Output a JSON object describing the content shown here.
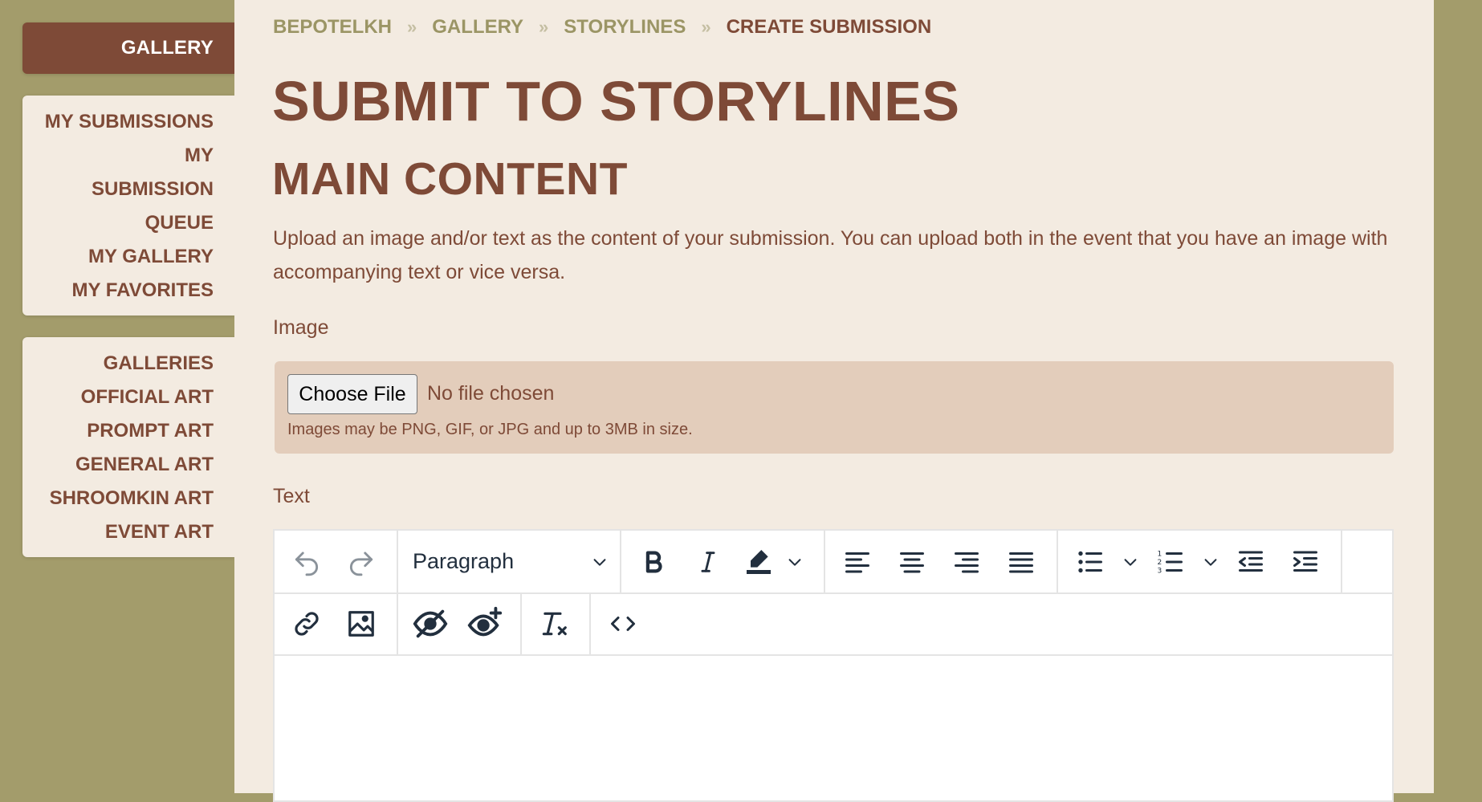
{
  "sidebar": {
    "header": "GALLERY",
    "group1": [
      "MY SUBMISSIONS",
      "MY SUBMISSION QUEUE",
      "MY GALLERY",
      "MY FAVORITES"
    ],
    "group2": [
      "GALLERIES",
      "OFFICIAL ART",
      "PROMPT ART",
      "GENERAL ART",
      "SHROOMKIN ART",
      "EVENT ART"
    ]
  },
  "breadcrumb": [
    "BEPOTELKH",
    "GALLERY",
    "STORYLINES",
    "CREATE SUBMISSION"
  ],
  "breadcrumb_sep": "»",
  "page_title": "SUBMIT TO STORYLINES",
  "section_title": "MAIN CONTENT",
  "description": "Upload an image and/or text as the content of your submission. You can upload both in the event that you have an image with accompanying text or vice versa.",
  "image_field": {
    "label": "Image",
    "button": "Choose File",
    "status": "No file chosen",
    "hint": "Images may be PNG, GIF, or JPG and up to 3MB in size."
  },
  "text_field": {
    "label": "Text",
    "block_format": "Paragraph"
  },
  "colors": {
    "accent": "#7e4a37",
    "background": "#a39c6b",
    "panel": "#f3ebe1",
    "upload_box": "#e3cdbb"
  },
  "toolbar_icons": {
    "row1": [
      "undo-icon",
      "redo-icon",
      "bold-icon",
      "italic-icon",
      "highlight-icon",
      "align-left-icon",
      "align-center-icon",
      "align-right-icon",
      "align-justify-icon",
      "bullet-list-icon",
      "numbered-list-icon",
      "outdent-icon",
      "indent-icon"
    ],
    "row2": [
      "link-icon",
      "image-icon",
      "hide-icon",
      "reveal-icon",
      "clear-format-icon",
      "code-icon"
    ]
  }
}
